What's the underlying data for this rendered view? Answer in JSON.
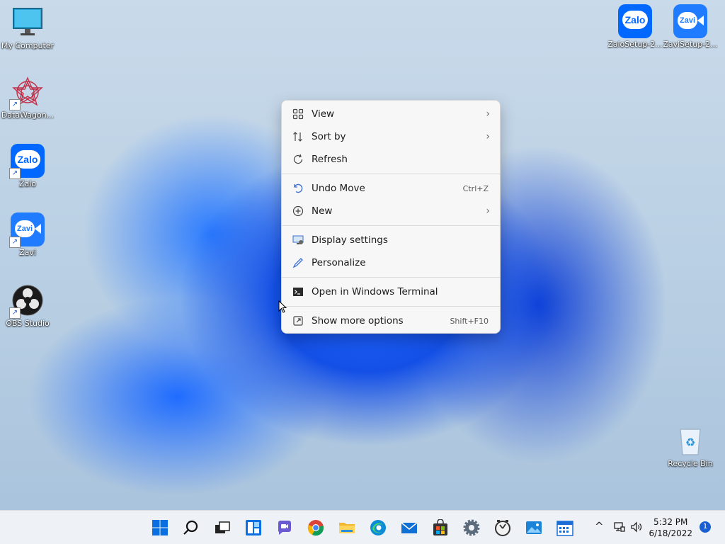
{
  "desktop": {
    "icons_left": [
      {
        "label": "My Computer",
        "icon": "monitor-icon"
      },
      {
        "label": "DataWagon...",
        "icon": "datawagon-icon"
      },
      {
        "label": "Zalo",
        "icon": "zalo-icon"
      },
      {
        "label": "Zavi",
        "icon": "zavi-icon"
      },
      {
        "label": "OBS Studio",
        "icon": "obs-icon"
      }
    ],
    "icons_right": [
      {
        "label": "ZaloSetup-2...",
        "icon": "zalo-icon",
        "badge": "Zalo"
      },
      {
        "label": "ZaviSetup-2...",
        "icon": "zavi-icon",
        "badge": "Zavi"
      }
    ],
    "recycle_bin": {
      "label": "Recycle Bin"
    },
    "zalo_text": "Zalo",
    "zavi_text": "Zavi"
  },
  "context_menu": {
    "items": [
      {
        "label": "View",
        "shortcut": "",
        "submenu": true,
        "icon": "grid-view-icon"
      },
      {
        "label": "Sort by",
        "shortcut": "",
        "submenu": true,
        "icon": "sort-icon"
      },
      {
        "label": "Refresh",
        "shortcut": "",
        "submenu": false,
        "icon": "refresh-icon"
      },
      {
        "label": "Undo Move",
        "shortcut": "Ctrl+Z",
        "submenu": false,
        "icon": "undo-icon"
      },
      {
        "label": "New",
        "shortcut": "",
        "submenu": true,
        "icon": "new-plus-icon"
      },
      {
        "label": "Display settings",
        "shortcut": "",
        "submenu": false,
        "icon": "display-icon"
      },
      {
        "label": "Personalize",
        "shortcut": "",
        "submenu": false,
        "icon": "pen-icon"
      },
      {
        "label": "Open in Windows Terminal",
        "shortcut": "",
        "submenu": false,
        "icon": "terminal-icon"
      },
      {
        "label": "Show more options",
        "shortcut": "Shift+F10",
        "submenu": false,
        "icon": "more-options-icon"
      }
    ],
    "chevron": "›"
  },
  "taskbar": {
    "apps": [
      "start-icon",
      "search-icon",
      "task-view-icon",
      "widgets-icon",
      "chat-icon",
      "chrome-icon",
      "file-explorer-icon",
      "edge-icon",
      "mail-icon",
      "store-icon",
      "settings-icon",
      "clock-app-icon",
      "photos-icon",
      "calendar-icon"
    ],
    "tray_chevron": "^",
    "time": "5:32 PM",
    "date": "6/18/2022",
    "notification_count": "1"
  }
}
